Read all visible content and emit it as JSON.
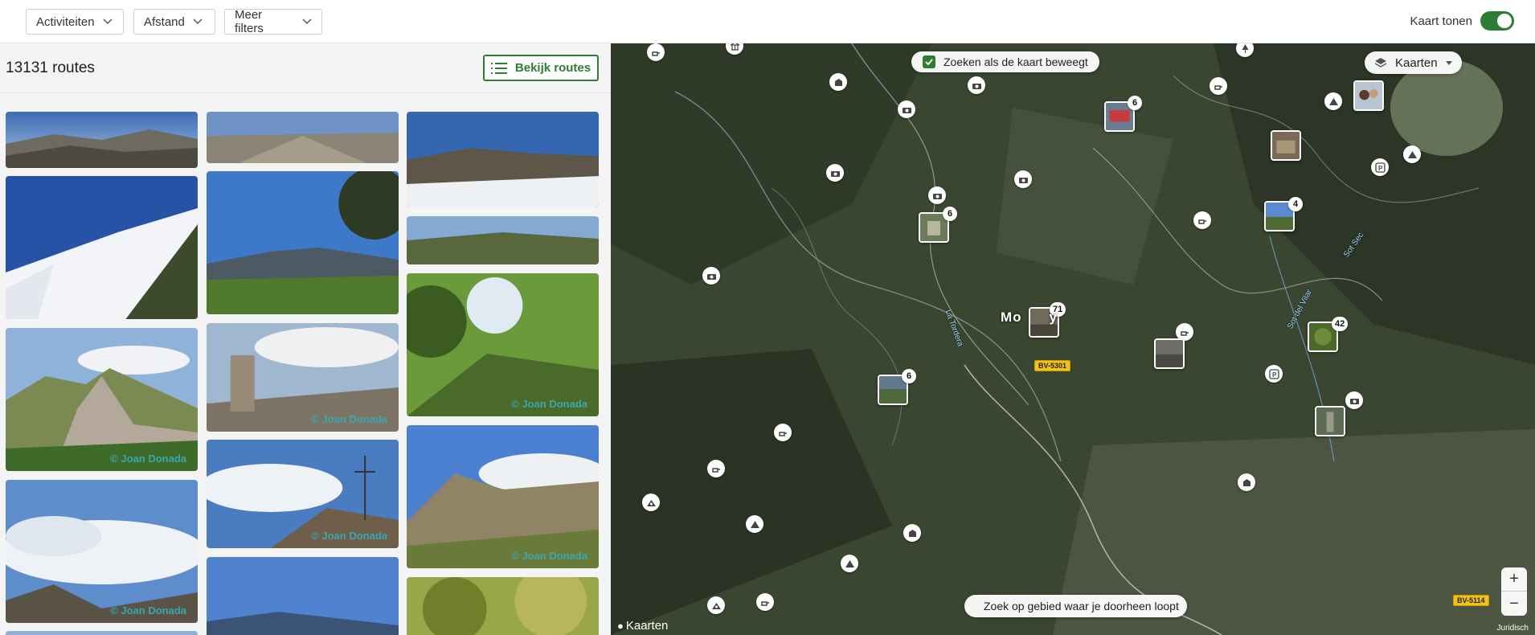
{
  "filters": {
    "activities": "Activiteiten",
    "distance": "Afstand",
    "more": "Meer filters",
    "map_toggle_label": "Kaart tonen"
  },
  "results": {
    "count": "13131 routes",
    "view_button": "Bekijk routes"
  },
  "photo_credit": "© Joan Donada",
  "map": {
    "search_on_move": "Zoeken als de kaart beweegt",
    "layers_button": "Kaarten",
    "area_search": "Zoek op gebied waar je doorheen loopt",
    "attribution": "Kaarten",
    "legal": "Juridisch",
    "place_name": "Mo",
    "place_name_tail": "y",
    "road_1": "BV-5301",
    "road_2": "BV-5114",
    "stream_1": "La Tordera",
    "stream_2": "Sot del Vilar",
    "stream_3": "Sot Sec",
    "zoom_in": "+",
    "zoom_out": "−",
    "clusters": [
      "6",
      "6",
      "4",
      "71",
      "42",
      "6"
    ]
  },
  "colors": {
    "accent": "#2e7d32",
    "credit": "#3aa6b0",
    "road": "#f3c11b"
  }
}
